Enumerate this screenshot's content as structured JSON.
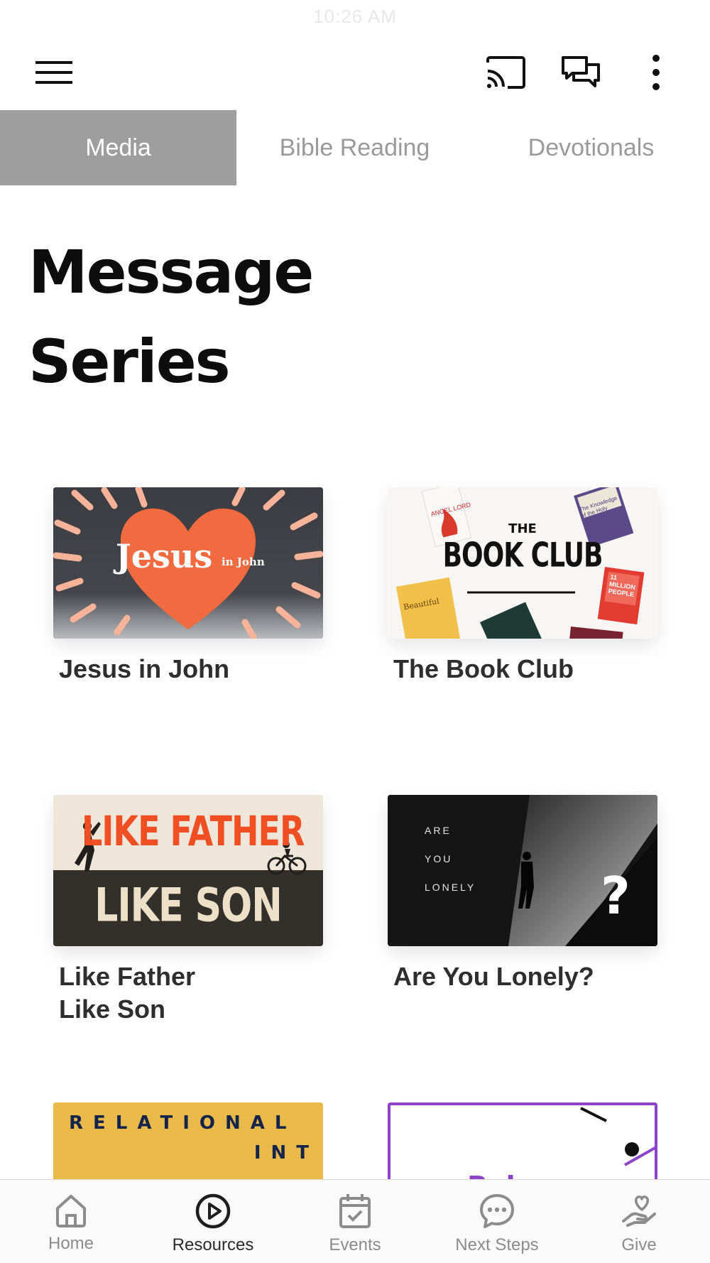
{
  "status": {
    "time": "10:26 AM"
  },
  "tabs": [
    {
      "label": "Media",
      "active": true
    },
    {
      "label": "Bible Reading",
      "active": false
    },
    {
      "label": "Devotionals",
      "active": false
    }
  ],
  "page": {
    "title": "Message Series"
  },
  "series": [
    {
      "title": "Jesus in John",
      "thumb": {
        "main": "Jesus",
        "small": "in John",
        "accent": "#f26a3f",
        "ray": "#f7b39a"
      }
    },
    {
      "title": "The Book Club",
      "thumb": {
        "line1": "THE",
        "line2": "BOOK CLUB",
        "books": [
          "ANGEL LORD",
          "Beautiful",
          "The Knowledge of the Holy",
          "11 MILLION PEOPLE"
        ]
      }
    },
    {
      "title": "Like Father\nLike Son",
      "thumb": {
        "top": "LIKE FATHER",
        "bottom": "LIKE SON",
        "accent": "#f04e23"
      }
    },
    {
      "title": "Are You Lonely?",
      "thumb": {
        "lines": [
          "ARE",
          "YOU",
          "LONELY"
        ],
        "mark": "?"
      }
    },
    {
      "title": "",
      "thumb": {
        "line1": "RELATIONAL",
        "line2": "INT",
        "bg": "#e9b94a"
      }
    },
    {
      "title": "",
      "thumb": {
        "text": "Balance",
        "accent": "#8e44c9"
      }
    }
  ],
  "bottom_nav": [
    {
      "label": "Home",
      "icon": "home-icon",
      "active": false
    },
    {
      "label": "Resources",
      "icon": "play-circle-icon",
      "active": true
    },
    {
      "label": "Events",
      "icon": "calendar-check-icon",
      "active": false
    },
    {
      "label": "Next Steps",
      "icon": "chat-bubble-icon",
      "active": false
    },
    {
      "label": "Give",
      "icon": "heart-hand-icon",
      "active": false
    }
  ]
}
